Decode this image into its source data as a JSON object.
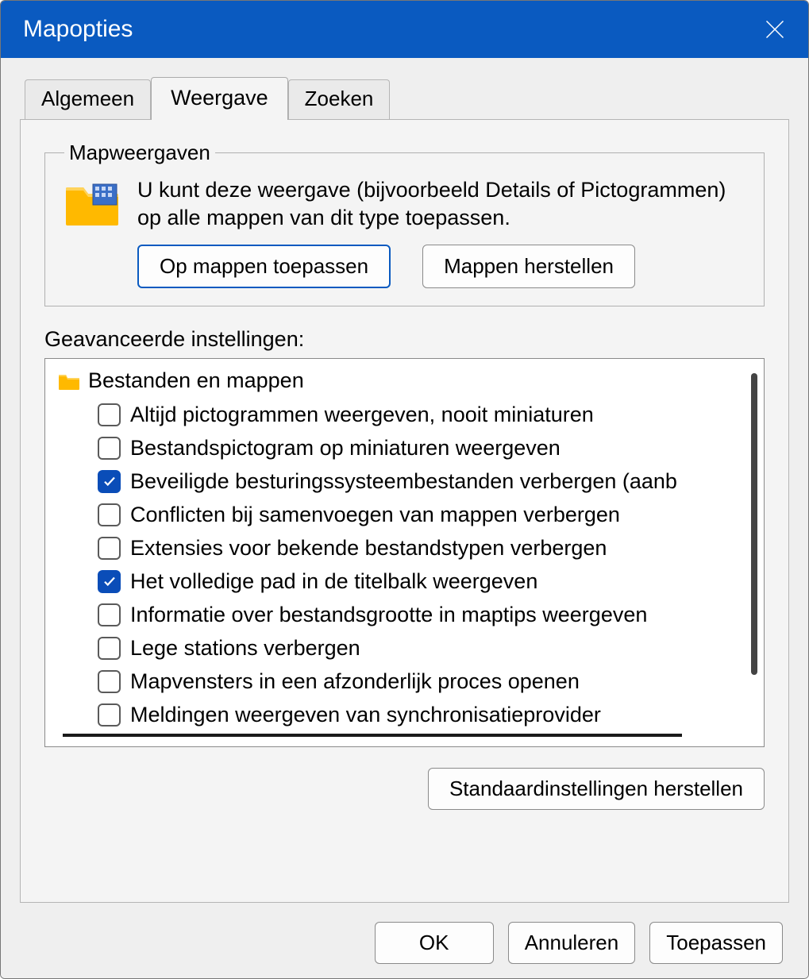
{
  "dialog": {
    "title": "Mapopties"
  },
  "tabs": {
    "general": "Algemeen",
    "view": "Weergave",
    "search": "Zoeken",
    "active": "view"
  },
  "folderViews": {
    "legend": "Mapweergaven",
    "description": "U kunt deze weergave (bijvoorbeeld Details of Pictogrammen) op alle mappen van dit type toepassen.",
    "applyButton": "Op mappen toepassen",
    "resetButton": "Mappen herstellen"
  },
  "advanced": {
    "label": "Geavanceerde instellingen:",
    "rootLabel": "Bestanden en mappen",
    "items": [
      {
        "label": "Altijd pictogrammen weergeven, nooit miniaturen",
        "checked": false
      },
      {
        "label": "Bestandspictogram op miniaturen weergeven",
        "checked": false
      },
      {
        "label": "Beveiligde besturingssysteembestanden verbergen (aanb",
        "checked": true
      },
      {
        "label": "Conflicten bij samenvoegen van mappen verbergen",
        "checked": false
      },
      {
        "label": "Extensies voor bekende bestandstypen verbergen",
        "checked": false
      },
      {
        "label": "Het volledige pad in de titelbalk weergeven",
        "checked": true
      },
      {
        "label": "Informatie over bestandsgrootte in maptips weergeven",
        "checked": false
      },
      {
        "label": "Lege stations verbergen",
        "checked": false
      },
      {
        "label": "Mapvensters in een afzonderlijk proces openen",
        "checked": false
      },
      {
        "label": "Meldingen weergeven van synchronisatieprovider",
        "checked": false
      }
    ],
    "restoreDefaults": "Standaardinstellingen herstellen"
  },
  "footer": {
    "ok": "OK",
    "cancel": "Annuleren",
    "apply": "Toepassen"
  }
}
